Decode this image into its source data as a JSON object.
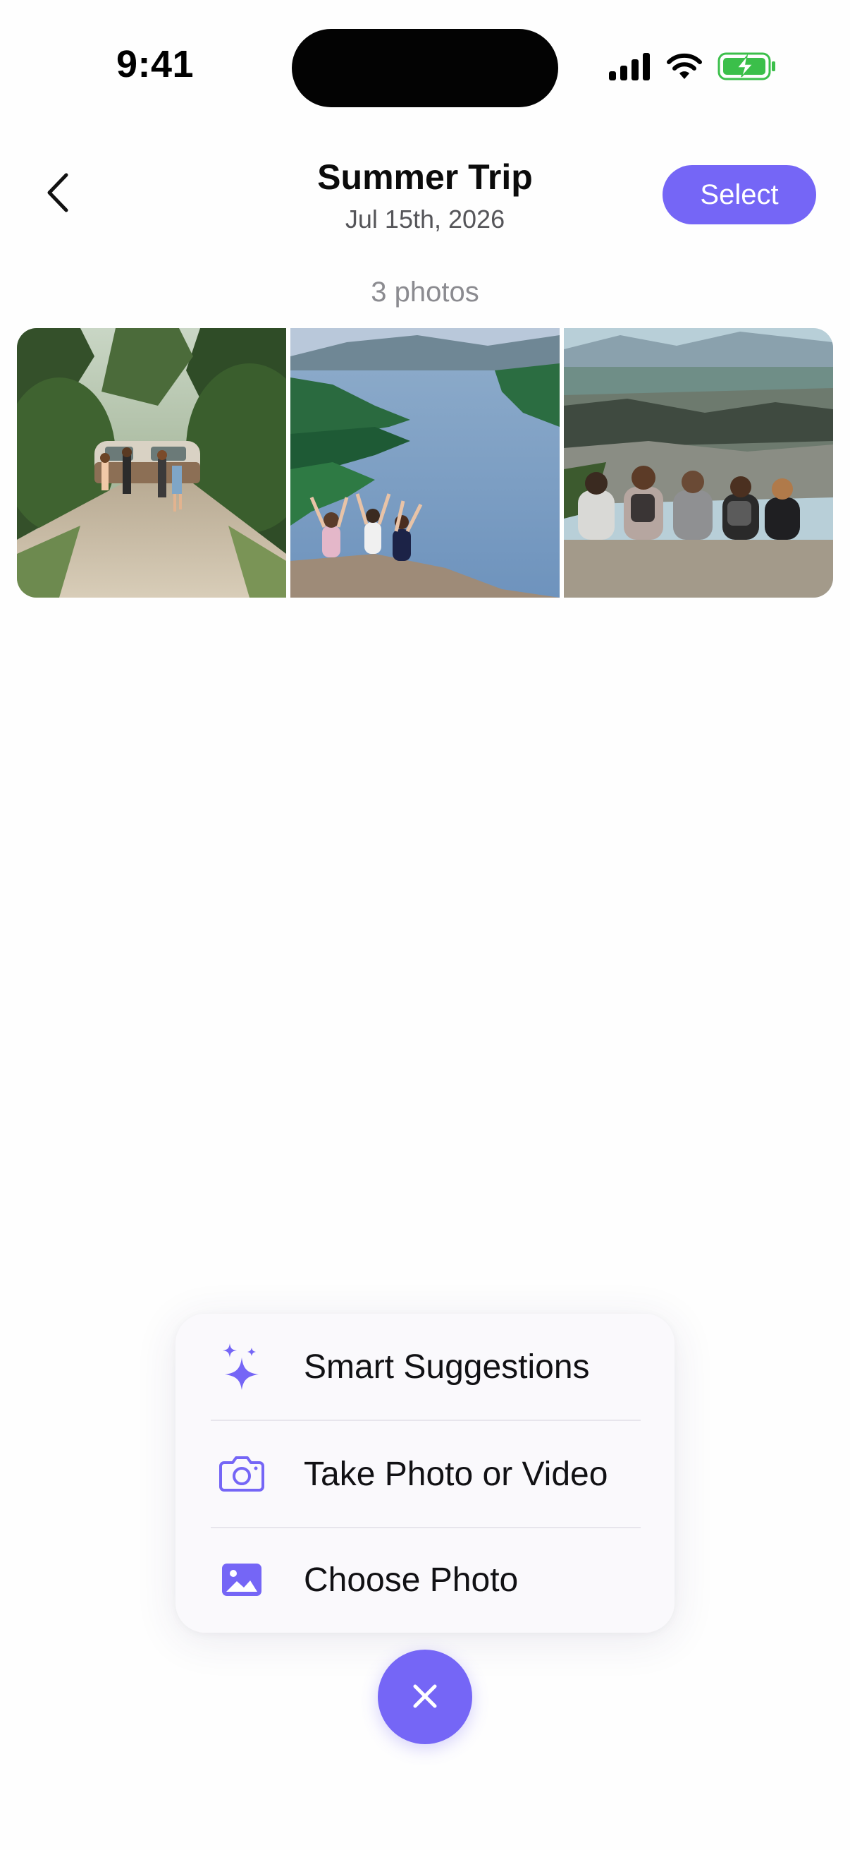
{
  "status_bar": {
    "time": "9:41",
    "icons": [
      "cellular-signal-icon",
      "wifi-icon",
      "battery-charging-icon"
    ],
    "battery_color": "#3bbf4a"
  },
  "header": {
    "back_icon": "chevron-left-icon",
    "title": "Summer Trip",
    "date": "Jul 15th, 2026",
    "select_label": "Select"
  },
  "album": {
    "photo_count": "3 photos",
    "photos": [
      {
        "name": "friends-van-forest-photo"
      },
      {
        "name": "lake-mountains-cheering-photo"
      },
      {
        "name": "hikers-mountain-view-photo"
      }
    ]
  },
  "add_menu": {
    "items": [
      {
        "label": "Smart Suggestions",
        "icon": "sparkles-icon"
      },
      {
        "label": "Take Photo or Video",
        "icon": "camera-icon"
      },
      {
        "label": "Choose Photo",
        "icon": "photo-icon"
      }
    ],
    "close_icon": "close-icon"
  },
  "colors": {
    "accent": "#7566f6",
    "menu_background": "#faf9fc",
    "secondary_text": "#8b8b90"
  }
}
